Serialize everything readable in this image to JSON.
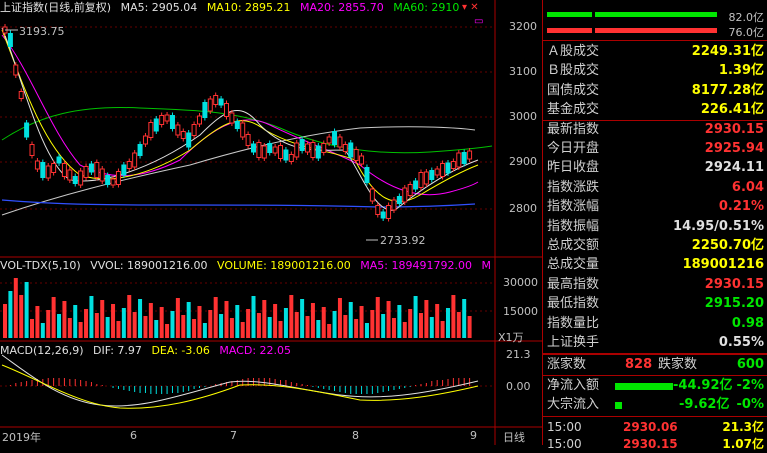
{
  "chart": {
    "title": "上证指数(日线,前复权)",
    "ma5": "MA5: 2905.04",
    "ma10": "MA10: 2895.21",
    "ma20": "MA20: 2855.70",
    "ma60": "MA60: 2910",
    "price_ticks": [
      "3200",
      "3100",
      "3000",
      "2900",
      "2800"
    ],
    "high_label": "3193.75",
    "low_label": "2733.92",
    "vol_header": "VOL-TDX(5,10)",
    "vvol": "VVOL: 189001216.00",
    "volume": "VOLUME: 189001216.00",
    "vol_ma5": "MA5: 189491792.00",
    "vol_m": "M",
    "vol_ticks": [
      "30000",
      "15000"
    ],
    "vol_unit": "X1万",
    "macd_header": "MACD(12,26,9)",
    "dif": "DIF: 7.97",
    "dea": "DEA: -3.06",
    "macd": "MACD: 22.05",
    "macd_ticks": [
      "21.3",
      "0.00"
    ],
    "months": [
      "2019年",
      "6",
      "7",
      "8",
      "9"
    ],
    "line_tab": "日线"
  },
  "panel": {
    "ratio_up": "82.0亿",
    "ratio_down": "76.0亿",
    "rows": [
      {
        "k": "Ａ股成交",
        "v": "2249.31亿",
        "c": "yellow"
      },
      {
        "k": "Ｂ股成交",
        "v": "1.39亿",
        "c": "yellow"
      },
      {
        "k": "国债成交",
        "v": "8177.28亿",
        "c": "yellow"
      },
      {
        "k": "基金成交",
        "v": "226.41亿",
        "c": "yellow"
      },
      {
        "k": "最新指数",
        "v": "2930.15",
        "c": "red"
      },
      {
        "k": "今日开盘",
        "v": "2925.94",
        "c": "red"
      },
      {
        "k": "昨日收盘",
        "v": "2924.11",
        "c": "white"
      },
      {
        "k": "指数涨跌",
        "v": "6.04",
        "c": "red"
      },
      {
        "k": "指数涨幅",
        "v": "0.21%",
        "c": "red"
      },
      {
        "k": "指数振幅",
        "v": "14.95/0.51%",
        "c": "white"
      },
      {
        "k": "总成交额",
        "v": "2250.70亿",
        "c": "yellow"
      },
      {
        "k": "总成交量",
        "v": "189001216",
        "c": "yellow"
      },
      {
        "k": "最高指数",
        "v": "2930.15",
        "c": "red"
      },
      {
        "k": "最低指数",
        "v": "2915.20",
        "c": "green"
      },
      {
        "k": "指数量比",
        "v": "0.98",
        "c": "green"
      },
      {
        "k": "上证换手",
        "v": "0.55%",
        "c": "white"
      }
    ],
    "up_label": "涨家数",
    "up_count": "828",
    "down_label": "跌家数",
    "down_count": "600",
    "netflow_label": "净流入额",
    "netflow_value": "-44.92亿",
    "netflow_pct": "-2%",
    "block_label": "大宗流入",
    "block_value": "-9.62亿",
    "block_pct": "-0%",
    "ticks": [
      {
        "time": "15:00",
        "price": "2930.06",
        "vol": "21.3亿"
      },
      {
        "time": "15:00",
        "price": "2930.15",
        "vol": "1.07亿"
      }
    ]
  }
}
